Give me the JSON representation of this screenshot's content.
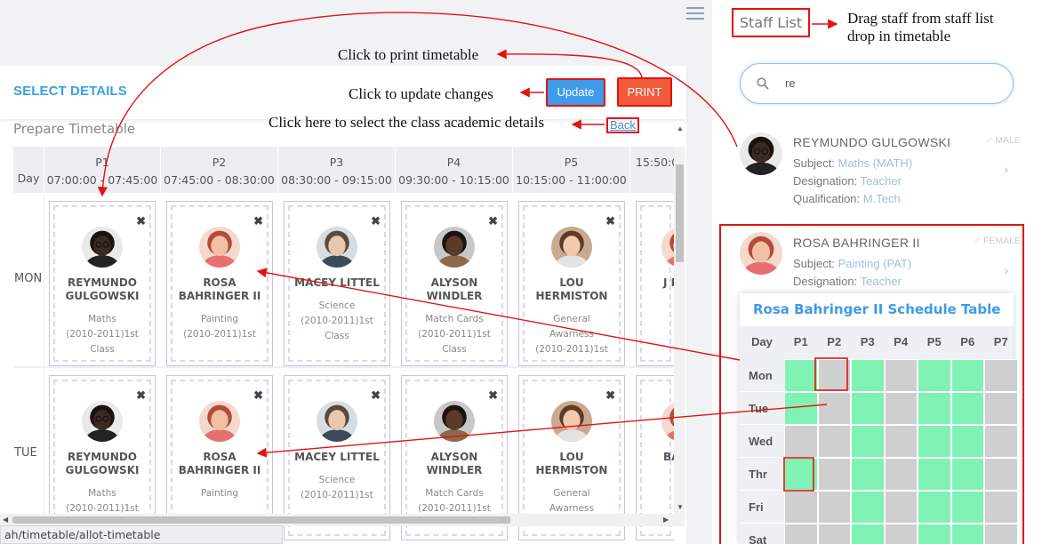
{
  "header": {
    "select_title": "SELECT DETAILS",
    "prepare_title": "Prepare Timetable",
    "update_label": "Update",
    "print_label": "PRINT",
    "back_label": "Back"
  },
  "timetable": {
    "day_header": "Day",
    "periods": [
      {
        "label": "P1",
        "time": "07:00:00 - 07:45:00"
      },
      {
        "label": "P2",
        "time": "07:45:00 - 08:30:00"
      },
      {
        "label": "P3",
        "time": "08:30:00 - 09:15:00"
      },
      {
        "label": "P4",
        "time": "09:30:00 - 10:15:00"
      },
      {
        "label": "P5",
        "time": "10:15:00 - 11:00:00"
      },
      {
        "label": "",
        "time": "15:50:0"
      }
    ],
    "days": [
      "MON",
      "TUE"
    ],
    "mon": [
      {
        "name": "REYMUNDO GULGOWSKI",
        "subject": "Maths",
        "class": "(2010-2011)1st",
        "extra": "Class",
        "avatar": "man-dark"
      },
      {
        "name": "ROSA BAHRINGER II",
        "subject": "Painting",
        "class": "(2010-2011)1st",
        "extra": "",
        "avatar": "woman-red"
      },
      {
        "name": "MACEY LITTEL",
        "subject": "Science",
        "class": "(2010-2011)1st",
        "extra": "Class",
        "avatar": "man-light"
      },
      {
        "name": "ALYSON WINDLER",
        "subject": "Match Cards",
        "class": "(2010-2011)1st",
        "extra": "Class",
        "avatar": "woman-dark"
      },
      {
        "name": "LOU HERMISTON",
        "subject": "General",
        "class": "Awarness",
        "extra": "(2010-2011)1st",
        "avatar": "woman-smile"
      },
      {
        "name": "J BA",
        "subject": "",
        "class": "",
        "extra": "",
        "avatar": "woman-red"
      }
    ],
    "tue": [
      {
        "name": "REYMUNDO GULGOWSKI",
        "subject": "Maths",
        "class": "(2010-2011)1st",
        "avatar": "man-dark"
      },
      {
        "name": "ROSA BAHRINGER II",
        "subject": "Painting",
        "class": "",
        "avatar": "woman-red"
      },
      {
        "name": "MACEY LITTEL",
        "subject": "Science",
        "class": "(2010-2011)1st",
        "avatar": "man-light"
      },
      {
        "name": "ALYSON WINDLER",
        "subject": "Match Cards",
        "class": "(2010-2011)1st",
        "avatar": "woman-dark"
      },
      {
        "name": "LOU HERMISTON",
        "subject": "General",
        "class": "Awarness",
        "avatar": "woman-smile"
      },
      {
        "name": "BA",
        "subject": "",
        "class": "",
        "avatar": "woman-red"
      }
    ]
  },
  "status_url": "ah/timetable/allot-timetable",
  "staff": {
    "title": "Staff List",
    "search_value": "re",
    "items": [
      {
        "name": "REYMUNDO GULGOWSKI",
        "gender": "MALE",
        "subject_label": "Subject:",
        "subject": "Maths (MATH)",
        "designation_label": "Designation:",
        "designation": "Teacher",
        "qualification_label": "Qualification:",
        "qualification": "M.Tech",
        "avatar": "man-dark"
      },
      {
        "name": "ROSA BAHRINGER II",
        "gender": "FEMALE",
        "subject_label": "Subject:",
        "subject": "Painting (PAT)",
        "designation_label": "Designation:",
        "designation": "Teacher",
        "avatar": "woman-red"
      }
    ]
  },
  "schedule": {
    "title": "Rosa Bahringer II Schedule Table",
    "headers": [
      "Day",
      "P1",
      "P2",
      "P3",
      "P4",
      "P5",
      "P6",
      "P7"
    ],
    "days": [
      "Mon",
      "Tue",
      "Wed",
      "Thr",
      "Fri",
      "Sat"
    ],
    "grid": [
      [
        "free",
        "busy",
        "free",
        "busy",
        "free",
        "free",
        "busy"
      ],
      [
        "free",
        "busy",
        "free",
        "busy",
        "free",
        "free",
        "busy"
      ],
      [
        "busy",
        "busy",
        "free",
        "busy",
        "free",
        "free",
        "busy"
      ],
      [
        "free",
        "busy",
        "free",
        "busy",
        "free",
        "free",
        "busy"
      ],
      [
        "busy",
        "busy",
        "free",
        "busy",
        "free",
        "free",
        "busy"
      ],
      [
        "busy",
        "busy",
        "free",
        "busy",
        "free",
        "free",
        "busy"
      ]
    ],
    "free_color": "#7ff2b4",
    "busy_color": "#cfcfcf"
  },
  "annotations": {
    "print": "Click to print timetable",
    "update": "Click to update changes",
    "back": "Click here to select the class academic details",
    "drag_line1": "Drag staff from staff list",
    "drag_line2": "drop in timetable"
  },
  "colors": {
    "accent": "#3d9be9",
    "print": "#f25a3c",
    "annotation": "#e31313"
  }
}
